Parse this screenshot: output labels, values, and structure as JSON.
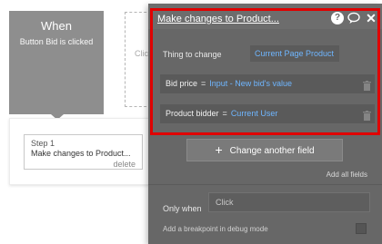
{
  "canvas": {
    "event": {
      "title": "When",
      "description": "Button Bid is clicked"
    },
    "placeholder_text": "Clic",
    "step": {
      "label": "Step 1",
      "action": "Make changes to Product...",
      "delete_label": "delete"
    }
  },
  "editor": {
    "title": "Make changes to Product...",
    "help_icon_glyph": "?",
    "close_icon_glyph": "✕",
    "thing_to_change": {
      "label": "Thing to change",
      "value": "Current Page Product"
    },
    "fields": [
      {
        "name": "Bid price",
        "operator": "=",
        "value": "Input - New bid's value"
      },
      {
        "name": "Product bidder",
        "operator": "=",
        "value": "Current User"
      }
    ],
    "change_another_field": {
      "plus": "+",
      "label": "Change another field"
    },
    "add_all_fields_label": "Add all fields",
    "only_when": {
      "label": "Only when",
      "placeholder": "Click"
    },
    "breakpoint_label": "Add a breakpoint in debug mode"
  },
  "colors": {
    "highlight_frame": "#e00000",
    "dynamic_value": "#6fb6ff",
    "editor_background": "#676767",
    "event_card": "#8e8e8e"
  },
  "icons": [
    "help-icon",
    "comment-icon",
    "close-icon",
    "trash-icon",
    "plus-icon"
  ]
}
